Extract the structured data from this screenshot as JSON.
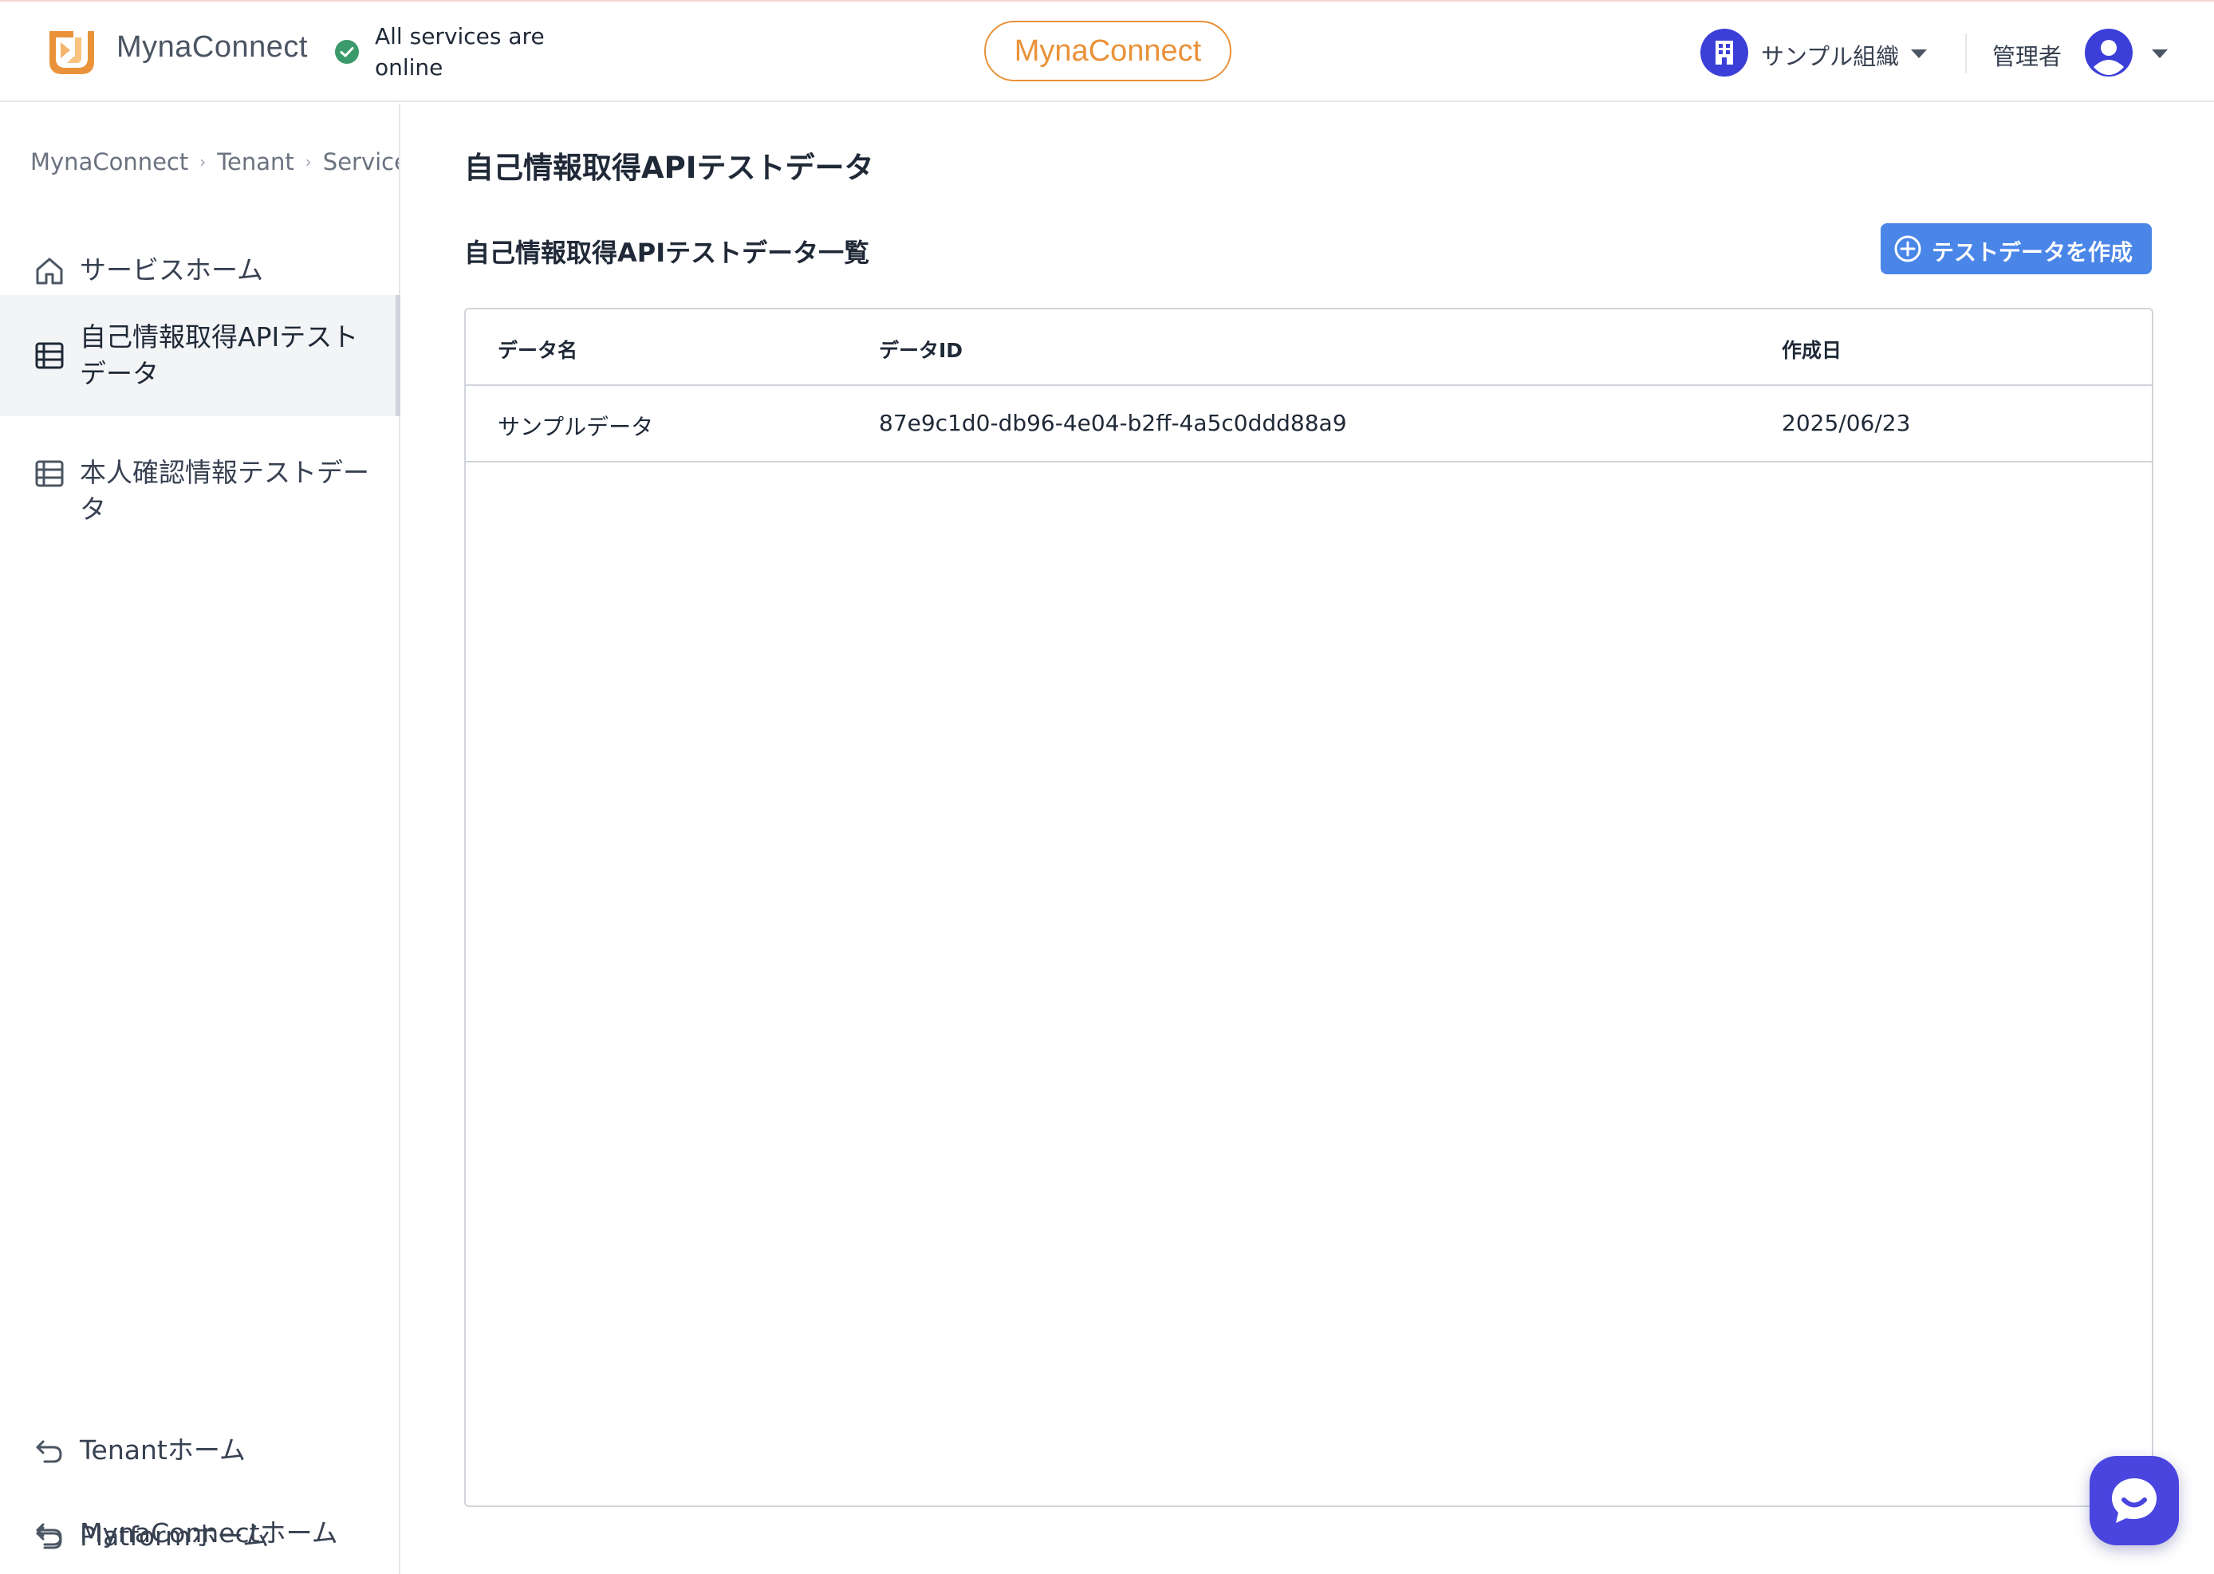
{
  "header": {
    "app_title": "MynaConnect",
    "status_text": "All services are online",
    "center_label": "MynaConnect",
    "organization": "サンプル組織",
    "role": "管理者",
    "brand_color": "#e9923a",
    "status_color": "#3a9a6a"
  },
  "sidebar": {
    "breadcrumb": [
      "MynaConnect",
      "Tenant",
      "Service"
    ],
    "items": [
      {
        "label": "サービスホーム",
        "icon": "home-icon",
        "active": false
      },
      {
        "label": "自己情報取得APIテストデータ",
        "icon": "table-icon",
        "active": true
      },
      {
        "label": "本人確認情報テストデータ",
        "icon": "table-icon",
        "active": false
      }
    ],
    "footer_items": [
      {
        "label": "Tenantホーム",
        "icon": "return-icon"
      },
      {
        "label": "MynaConnectホーム",
        "icon": "return-icon"
      },
      {
        "label": "Platformホーム",
        "icon": "return-icon"
      }
    ]
  },
  "main": {
    "page_title": "自己情報取得APIテストデータ",
    "section_title": "自己情報取得APIテストデータ一覧",
    "create_button": "テストデータを作成",
    "accent_color": "#4a86e8",
    "table": {
      "columns": [
        "データ名",
        "データID",
        "作成日"
      ],
      "rows": [
        [
          "サンプルデータ",
          "87e9c1d0-db96-4e04-b2ff-4a5c0ddd88a9",
          "2025/06/23"
        ]
      ]
    }
  },
  "chat": {
    "icon": "chat-icon"
  }
}
